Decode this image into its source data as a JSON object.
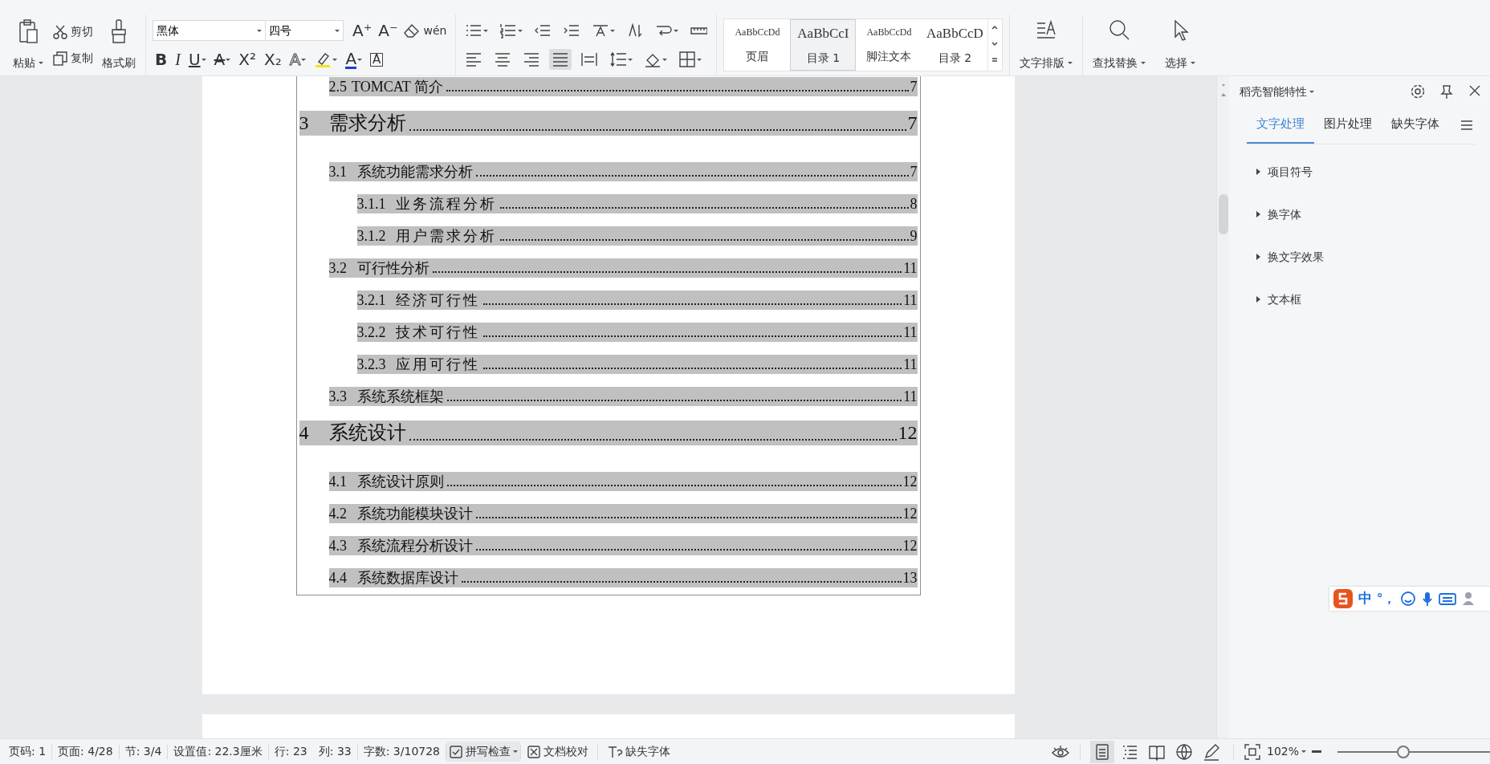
{
  "ribbon": {
    "clipboard": {
      "paste": "粘贴",
      "cut": "剪切",
      "copy": "复制",
      "format_painter": "格式刷"
    },
    "font": {
      "name": "黑体",
      "size": "四号",
      "grow": "A⁺",
      "shrink": "A⁻",
      "pinyin": "wén",
      "format_buttons": [
        {
          "kind": "bold",
          "label": "B"
        },
        {
          "kind": "italic",
          "label": "I"
        },
        {
          "kind": "underline",
          "label": "U"
        },
        {
          "kind": "strike",
          "label": "A"
        },
        {
          "kind": "superscript",
          "label": "X²"
        },
        {
          "kind": "subscript",
          "label": "X₂"
        },
        {
          "kind": "effect",
          "label": "A"
        },
        {
          "kind": "highlight"
        },
        {
          "kind": "color",
          "label": "A"
        },
        {
          "kind": "border",
          "label": "A"
        }
      ]
    },
    "paragraph": {
      "justify_selected": true
    },
    "styles": [
      {
        "preview": "AaBbCcDd",
        "label": "页眉",
        "selected": false
      },
      {
        "preview": "AaBbCcI",
        "label": "目录 1",
        "selected": true
      },
      {
        "preview": "AaBbCcDd",
        "label": "脚注文本",
        "selected": false
      },
      {
        "preview": "AaBbCcD",
        "label": "目录 2",
        "selected": false
      }
    ],
    "tools": [
      {
        "kind": "layout",
        "label": "文字排版"
      },
      {
        "kind": "find",
        "label": "查找替换"
      },
      {
        "kind": "select",
        "label": "选择"
      }
    ]
  },
  "document": {
    "toc_continued": [
      {
        "number": "2.5",
        "title": "TOMCAT 简介",
        "page": "7"
      }
    ],
    "toc": [
      {
        "number": "3",
        "title": "需求分析",
        "page": "7",
        "children": [
          {
            "number": "3.1",
            "title": "系统功能需求分析",
            "page": "7",
            "children": [
              {
                "number": "3.1.1",
                "title": "业务流程分析",
                "page": "8"
              },
              {
                "number": "3.1.2",
                "title": "用户需求分析",
                "page": "9"
              }
            ]
          },
          {
            "number": "3.2",
            "title": "可行性分析",
            "page": "11",
            "children": [
              {
                "number": "3.2.1",
                "title": "经济可行性",
                "page": "11"
              },
              {
                "number": "3.2.2",
                "title": "技术可行性",
                "page": "11"
              },
              {
                "number": "3.2.3",
                "title": "应用可行性",
                "page": "11"
              }
            ]
          },
          {
            "number": "3.3",
            "title": "系统系统框架",
            "page": "11"
          }
        ]
      },
      {
        "number": "4",
        "title": "系统设计",
        "page": "12",
        "children": [
          {
            "number": "4.1",
            "title": "系统设计原则",
            "page": "12"
          },
          {
            "number": "4.2",
            "title": "系统功能模块设计",
            "page": "12"
          },
          {
            "number": "4.3",
            "title": "系统流程分析设计",
            "page": "12"
          },
          {
            "number": "4.4",
            "title": "系统数据库设计",
            "page": "13"
          }
        ]
      }
    ]
  },
  "side_panel": {
    "title": "稻壳智能特性",
    "tabs": [
      {
        "label": "文字处理",
        "selected": true
      },
      {
        "label": "图片处理",
        "selected": false
      },
      {
        "label": "缺失字体",
        "selected": false
      }
    ],
    "items": [
      {
        "label": "项目符号",
        "expanded": false
      },
      {
        "label": "换字体",
        "expanded": false
      },
      {
        "label": "换文字效果",
        "expanded": false
      },
      {
        "label": "文本框",
        "expanded": false
      }
    ]
  },
  "ime_toolbar": {
    "mode": "中",
    "punctuation": "°，"
  },
  "status_bar": {
    "fields": [
      "页码: 1",
      "页面: 4/28",
      "节: 3/4",
      "设置值: 22.3厘米",
      "行: 23",
      "列: 33",
      "字数: 3/10728"
    ],
    "spell_check": "拼写检查",
    "proofread": "文档校对",
    "missing_fonts": "缺失字体",
    "views": [
      {
        "kind": "page",
        "selected": true
      },
      {
        "kind": "outline",
        "selected": false
      },
      {
        "kind": "reading",
        "selected": false
      },
      {
        "kind": "web",
        "selected": false
      },
      {
        "kind": "writing",
        "selected": false
      }
    ],
    "zoom": "102%",
    "zoom_slider": {
      "level": 0.43
    }
  }
}
